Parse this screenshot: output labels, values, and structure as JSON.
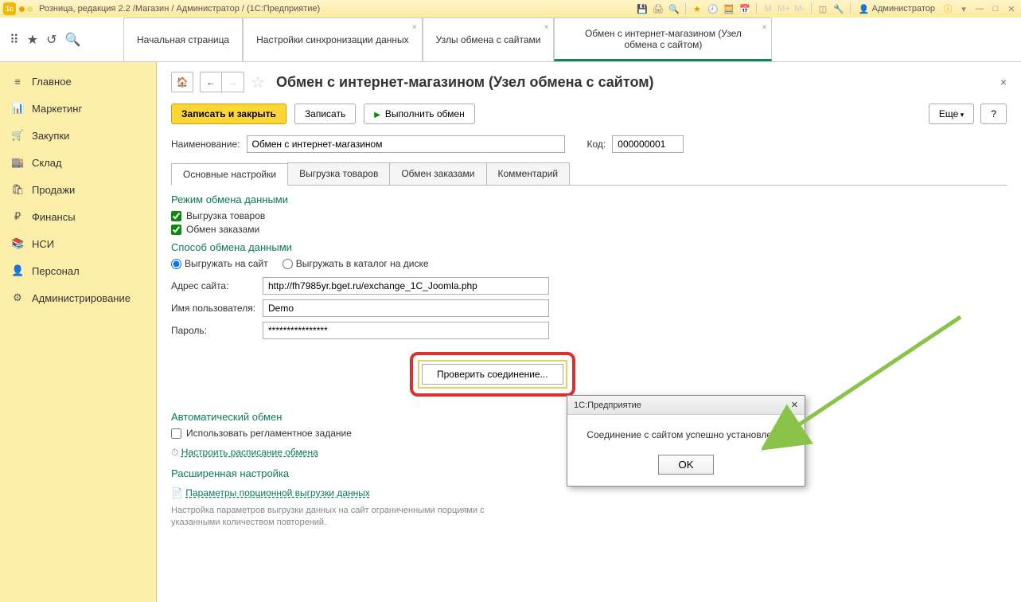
{
  "titlebar": {
    "text": "Розница, редакция 2.2 /Магазин / Администратор /  (1С:Предприятие)",
    "user": "Администратор"
  },
  "tabs": [
    {
      "label": "Начальная страница",
      "closable": false
    },
    {
      "label": "Настройки синхронизации данных",
      "closable": true
    },
    {
      "label": "Узлы обмена с сайтами",
      "closable": true
    },
    {
      "label": "Обмен с интернет-магазином (Узел обмена с сайтом)",
      "closable": true,
      "active": true
    }
  ],
  "sidebar": [
    {
      "icon": "≡",
      "label": "Главное"
    },
    {
      "icon": "📊",
      "label": "Маркетинг"
    },
    {
      "icon": "🛒",
      "label": "Закупки"
    },
    {
      "icon": "🏬",
      "label": "Склад"
    },
    {
      "icon": "🛍",
      "label": "Продажи"
    },
    {
      "icon": "₽",
      "label": "Финансы"
    },
    {
      "icon": "📚",
      "label": "НСИ"
    },
    {
      "icon": "👤",
      "label": "Персонал"
    },
    {
      "icon": "⚙",
      "label": "Администрирование"
    }
  ],
  "page": {
    "title": "Обмен с интернет-магазином (Узел обмена с сайтом)",
    "toolbar": {
      "save_close": "Записать и закрыть",
      "save": "Записать",
      "run": "Выполнить обмен",
      "more": "Еще",
      "help": "?"
    },
    "name_label": "Наименование:",
    "name_value": "Обмен с интернет-магазином",
    "code_label": "Код:",
    "code_value": "000000001",
    "inner_tabs": [
      "Основные настройки",
      "Выгрузка товаров",
      "Обмен заказами",
      "Комментарий"
    ],
    "sec1_title": "Режим обмена данными",
    "chk_export": "Выгрузка товаров",
    "chk_orders": "Обмен заказами",
    "sec2_title": "Способ обмена данными",
    "radio_site": "Выгружать на сайт",
    "radio_disk": "Выгружать в каталог на диске",
    "addr_label": "Адрес сайта:",
    "addr_value": "http://fh7985yr.bget.ru/exchange_1C_Joomla.php",
    "user_label": "Имя пользователя:",
    "user_value": "Demo",
    "pass_label": "Пароль:",
    "pass_value": "****************",
    "test_btn": "Проверить соединение...",
    "sec3_title": "Автоматический обмен",
    "chk_scheduled": "Использовать регламентное задание",
    "link_schedule": "Настроить расписание обмена",
    "sec4_title": "Расширенная настройка",
    "link_portion": "Параметры порционной выгрузки данных",
    "hint": "Настройка параметров выгрузки данных на сайт ограниченными порциями с указанными количеством повторений."
  },
  "dialog": {
    "title": "1С:Предприятие",
    "body": "Соединение с сайтом успешно установлено.",
    "ok": "OK"
  }
}
